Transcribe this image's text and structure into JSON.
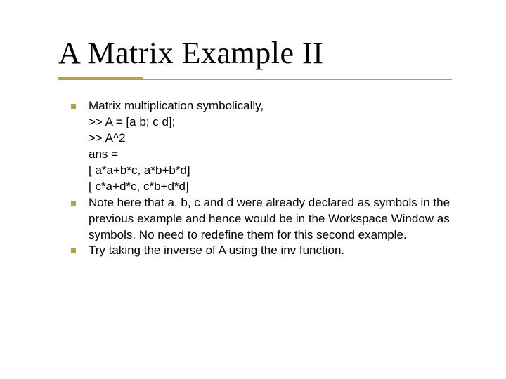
{
  "slide": {
    "title": "A Matrix Example II",
    "bullets": [
      {
        "lead": "Matrix multiplication symbolically,",
        "lines": [
          ">> A = [a b; c d];",
          ">> A^2",
          "ans =",
          "[ a*a+b*c,  a*b+b*d]",
          "[ c*a+d*c,  c*b+d*d]"
        ]
      },
      {
        "lead": "Note here that a, b, c and d were already declared as symbols in the previous example and hence would be in the Workspace Window as symbols.  No need to redefine them for this second example."
      },
      {
        "lead_before": "Try taking the inverse of A using the ",
        "lead_underlined": "inv",
        "lead_after": " function."
      }
    ]
  }
}
